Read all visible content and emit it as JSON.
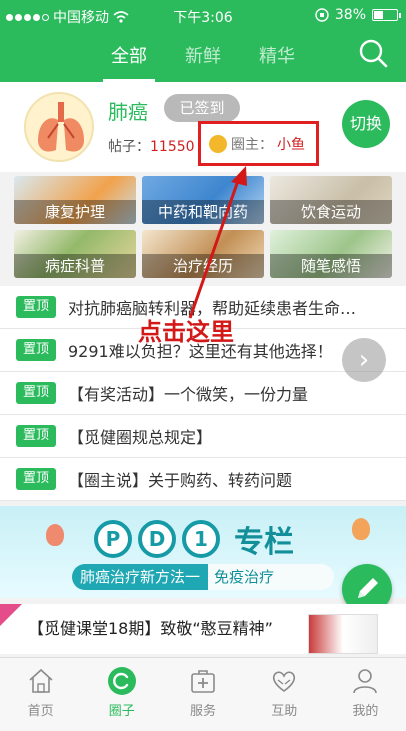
{
  "status_bar": {
    "carrier": "中国移动",
    "time": "下午3:06",
    "battery": "38%"
  },
  "header": {
    "tabs": [
      {
        "label": "全部",
        "active": true
      },
      {
        "label": "新鲜",
        "active": false
      },
      {
        "label": "精华",
        "active": false
      }
    ],
    "accent_color": "#2bbb5d"
  },
  "circle": {
    "name": "肺癌",
    "signed_label": "已签到",
    "posts_label": "帖子：",
    "posts_count": "11550",
    "owner_label": "圈主：",
    "owner_name": "小鱼",
    "switch_label": "切换"
  },
  "categories": [
    {
      "label": "康复护理"
    },
    {
      "label": "中药和靶向药"
    },
    {
      "label": "饮食运动"
    },
    {
      "label": "病症科普"
    },
    {
      "label": "治疗经历"
    },
    {
      "label": "随笔感悟"
    }
  ],
  "pinned": {
    "badge": "置顶",
    "items": [
      "对抗肺癌脑转利器，帮助延续患者生命…",
      "9291难以负担？这里还有其他选择！",
      "【有奖活动】一个微笑，一份力量",
      "【觅健圈规总规定】",
      "【圈主说】关于购药、转药问题"
    ]
  },
  "annotation": "点击这里",
  "banner": {
    "letters": [
      "P",
      "D",
      "1"
    ],
    "title": "专栏",
    "strip_left": "肺癌治疗新方法一",
    "strip_right": "免疫治疗"
  },
  "article": {
    "title": "【觅健课堂18期】致敬“憨豆精神”"
  },
  "bottom_nav": [
    {
      "label": "首页",
      "icon": "home-icon",
      "active": false
    },
    {
      "label": "圈子",
      "icon": "circle-icon",
      "active": true
    },
    {
      "label": "服务",
      "icon": "medical-kit-icon",
      "active": false
    },
    {
      "label": "互助",
      "icon": "heart-hands-icon",
      "active": false
    },
    {
      "label": "我的",
      "icon": "person-icon",
      "active": false
    }
  ]
}
